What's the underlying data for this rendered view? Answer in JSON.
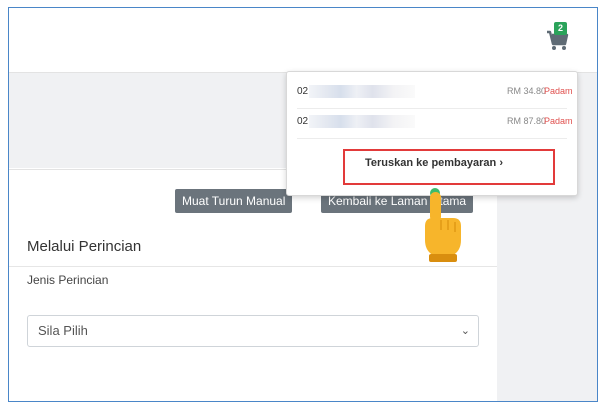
{
  "header": {
    "cart_count": "2"
  },
  "cart_dropdown": {
    "items": [
      {
        "code": "02",
        "price": "RM 34.80",
        "delete_label": "Padam"
      },
      {
        "code": "02",
        "price": "RM 87.80",
        "delete_label": "Padam"
      }
    ],
    "checkout_label": "Teruskan ke pembayaran"
  },
  "toolbar": {
    "download_manual_label": "Muat Turun Manual",
    "back_home_label": "Kembali ke Laman Utama"
  },
  "form": {
    "title": "Melalui Perincian",
    "field_label": "Jenis Perincian",
    "select_value": "Sila Pilih"
  },
  "colors": {
    "badge": "#2aa35a",
    "highlight": "#e23a3a",
    "delete": "#e0514f",
    "button": "#6b747c",
    "frame": "#4a86c8"
  }
}
